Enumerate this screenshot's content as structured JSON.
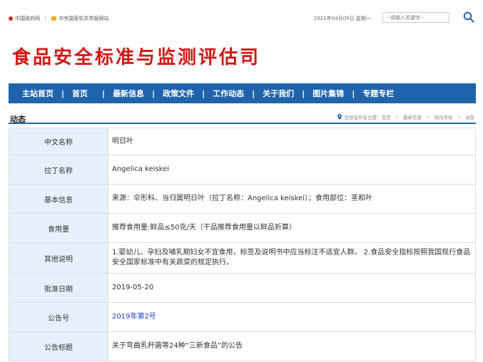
{
  "topbar": {
    "gov_link": "中国政府网",
    "separator": "|",
    "report_link": "中央国家机关举报网站",
    "date": "2021年04月05日 星期一",
    "search_placeholder": "--请输入关键字--"
  },
  "site_title": "食品安全标准与监测评估司",
  "nav": {
    "items": [
      "主站首页",
      "首页",
      "最新信息",
      "政策文件",
      "工作动态",
      "关于我们",
      "图片集锦",
      "专题专栏"
    ],
    "separator": "|"
  },
  "section": {
    "title": "动态",
    "breadcrumb_prefix": "您现在所在位置：",
    "breadcrumb": [
      "首页",
      "最新信息",
      "风险评估",
      "动态"
    ],
    "breadcrumb_separator": ">"
  },
  "table": {
    "rows": [
      {
        "label": "中文名称",
        "value": "明日叶"
      },
      {
        "label": "拉丁名称",
        "value": "Angelica keiskei"
      },
      {
        "label": "基本信息",
        "value": "来源：伞形科、当归属明日叶（拉丁名称：Angelica keiskei）；食用部位：茎和叶"
      },
      {
        "label": "食用量",
        "value": "推荐食用量:鲜品≤50克/天（干品推荐食用量以鲜品折算）"
      },
      {
        "label": "其他说明",
        "value": "1.婴幼儿、孕妇及哺乳期妇女不宜食用，标签及说明书中应当标注不适宜人群。 2.食品安全指标按照我国现行食品安全国家标准中有关蔬菜的规定执行。"
      },
      {
        "label": "批准日期",
        "value": "2019-05-20"
      },
      {
        "label": "公告号",
        "value": "2019年第2号"
      },
      {
        "label": "公告标题",
        "value": "关于弯曲乳杆菌等24种“三新食品”的公告"
      }
    ]
  },
  "colors": {
    "title_red": "#d31512",
    "nav_blue": "#1f64ab",
    "label_bg": "#e6f0fa",
    "link_blue": "#1a43c4"
  }
}
